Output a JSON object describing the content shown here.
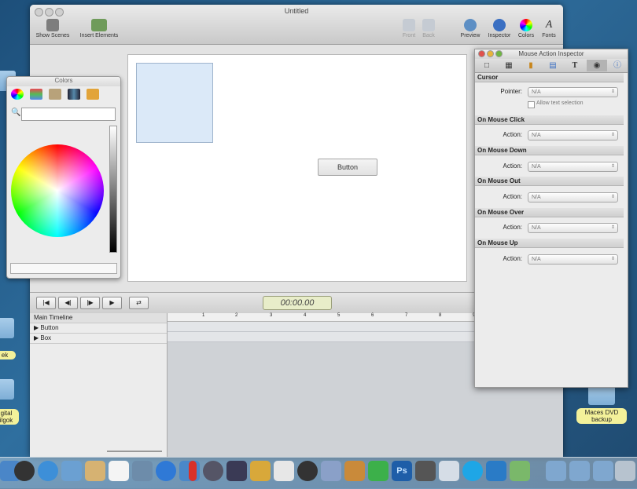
{
  "window": {
    "title": "Untitled",
    "toolbar": {
      "show_scenes": "Show Scenes",
      "insert_elements": "Insert Elements",
      "front": "Front",
      "back": "Back",
      "preview": "Preview",
      "inspector": "Inspector",
      "colors": "Colors",
      "fonts": "Fonts"
    }
  },
  "stage": {
    "button_label": "Button"
  },
  "timeline": {
    "timecode": "00:00.00",
    "header": "Main Timeline",
    "rows": [
      "Button",
      "Box"
    ],
    "ruler_ticks": [
      "1",
      "2",
      "3",
      "4",
      "5",
      "6",
      "7",
      "8",
      "9"
    ]
  },
  "colors_panel": {
    "title": "Colors"
  },
  "inspector": {
    "title": "Mouse Action Inspector",
    "sections": {
      "cursor": "Cursor",
      "pointer_label": "Pointer:",
      "pointer_value": "N/A",
      "allow_selection": "Allow text selection",
      "click": "On Mouse Click",
      "down": "On Mouse Down",
      "out": "On Mouse Out",
      "over": "On Mouse Over",
      "up": "On Mouse Up",
      "action_label": "Action:",
      "action_value": "N/A"
    }
  },
  "desktop": {
    "label_left_1": "ek",
    "label_left_2": "gital\nilgok",
    "dvd_label": "Maces DVD backup"
  },
  "colors": {
    "accent": "#4a7fc0",
    "timecode_bg": "#e8edc9"
  }
}
